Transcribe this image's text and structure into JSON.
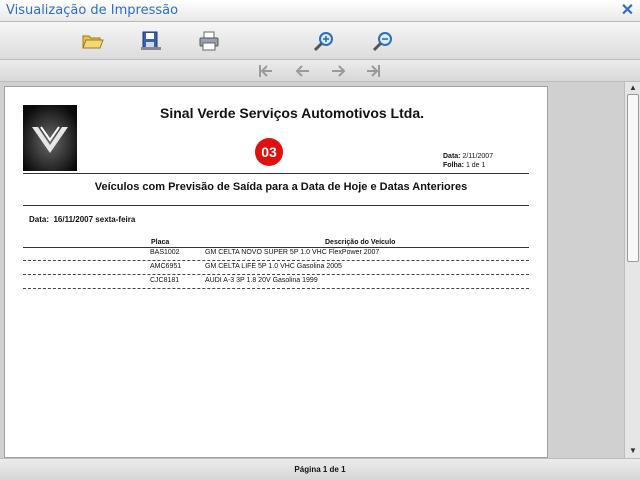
{
  "window": {
    "title": "Visualização de Impressão",
    "close_icon": "close-icon"
  },
  "toolbar": {
    "items": [
      {
        "name": "open",
        "icon": "folder-open-icon"
      },
      {
        "name": "save",
        "icon": "save-disk-icon"
      },
      {
        "name": "print",
        "icon": "printer-icon"
      },
      {
        "name": "zoom_in",
        "icon": "zoom-in-icon"
      },
      {
        "name": "zoom_out",
        "icon": "zoom-out-icon"
      }
    ]
  },
  "navigation": {
    "items": [
      {
        "name": "first",
        "icon": "first-page-icon",
        "enabled": false
      },
      {
        "name": "prev",
        "icon": "previous-page-icon",
        "enabled": false
      },
      {
        "name": "next",
        "icon": "next-page-icon",
        "enabled": false
      },
      {
        "name": "last",
        "icon": "last-page-icon",
        "enabled": false
      }
    ]
  },
  "report": {
    "company": "Sinal Verde Serviços Automotivos Ltda.",
    "badge": "03",
    "date_label": "Data:",
    "date_value": "2/11/2007",
    "page_label": "Folha:",
    "page_value": "1 de 1",
    "title": "Veículos com Previsão de Saída para a Data de Hoje e Datas Anteriores",
    "day_label": "Data:",
    "day_value": "16/11/2007 sexta-feira",
    "columns": {
      "plate": "Placa",
      "description": "Descrição do Veículo"
    },
    "rows": [
      {
        "plate": "BAS1002",
        "description": "GM CELTA NOVO SUPER 5P 1.0 VHC FlexPower 2007"
      },
      {
        "plate": "AMC6951",
        "description": "GM CELTA LIFE 5P 1.0 VHC Gasolina 2005"
      },
      {
        "plate": "CJC8181",
        "description": "AUDI A-3 3P 1.8 20V Gasolina 1999"
      }
    ]
  },
  "status": {
    "page_text": "Página 1 de 1"
  },
  "colors": {
    "accent": "#2d6ec9",
    "badge": "#e01010"
  }
}
